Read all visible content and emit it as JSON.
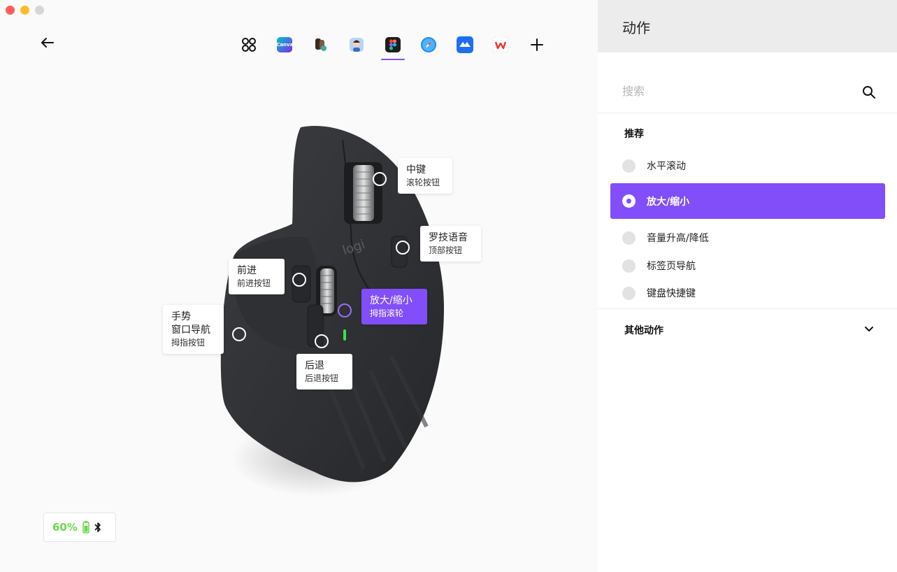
{
  "window": {
    "controls": [
      "close",
      "minimize",
      "maximize"
    ]
  },
  "toolbar": {
    "back_icon": "arrow-left-icon",
    "apps": [
      {
        "name": "all-apps",
        "icon": "grid-circles-icon",
        "label": ""
      },
      {
        "name": "canva",
        "icon": "canva-app-icon",
        "label": "Canva",
        "color": "#3aa0ff"
      },
      {
        "name": "app-3",
        "icon": "profile-app-icon",
        "label": "",
        "color": "#6d5a4e"
      },
      {
        "name": "app-4",
        "icon": "avatar-app-icon",
        "label": "",
        "color": "#8fb7e8"
      },
      {
        "name": "figma",
        "icon": "figma-app-icon",
        "label": "",
        "color": "#1e1e1e",
        "active": true
      },
      {
        "name": "safari",
        "icon": "compass-app-icon",
        "label": "",
        "color": "#1e8cf0"
      },
      {
        "name": "tencent-meeting",
        "icon": "meeting-app-icon",
        "label": "",
        "color": "#1f6ef0"
      },
      {
        "name": "wps",
        "icon": "wps-app-icon",
        "label": "W",
        "color": "#e8362d"
      }
    ],
    "add_icon": "plus-icon"
  },
  "mouse": {
    "logo_text": "logi",
    "callouts": [
      {
        "key": "middle",
        "title": "中键",
        "subtitle": "滚轮按钮"
      },
      {
        "key": "voice",
        "title": "罗技语音",
        "subtitle": "顶部按钮"
      },
      {
        "key": "forward",
        "title": "前进",
        "subtitle": "前进按钮"
      },
      {
        "key": "zoom",
        "title": "放大/缩小",
        "subtitle": "拇指滚轮",
        "active": true
      },
      {
        "key": "gesture",
        "title": "手势\n窗口导航",
        "subtitle": "拇指按钮"
      },
      {
        "key": "back",
        "title": "后退",
        "subtitle": "后退按钮"
      }
    ]
  },
  "status": {
    "battery_percent": "60%",
    "battery_level": 0.6,
    "connection_icon": "bluetooth-icon",
    "accent_color": "#6ad84b"
  },
  "panel": {
    "title": "动作",
    "search_placeholder": "搜索",
    "recommended_label": "推荐",
    "options": [
      {
        "label": "水平滚动",
        "selected": false
      },
      {
        "label": "放大/缩小",
        "selected": true
      },
      {
        "label": "音量升高/降低",
        "selected": false
      },
      {
        "label": "标签页导航",
        "selected": false
      },
      {
        "label": "键盘快捷键",
        "selected": false
      }
    ],
    "more_label": "其他动作",
    "accent_color": "#814efa"
  }
}
